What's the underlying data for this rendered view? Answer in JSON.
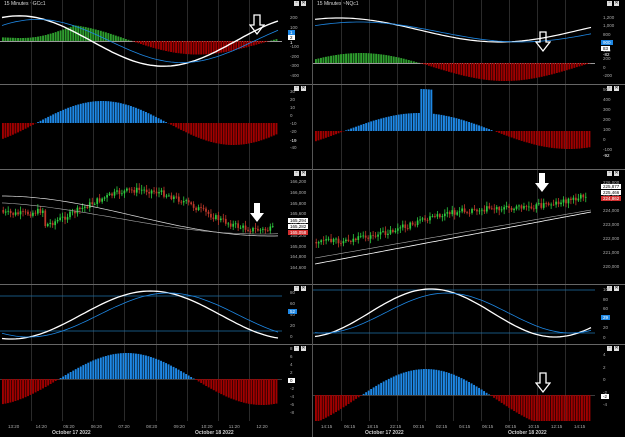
{
  "left": {
    "title": "15 Minutes ~GCc1",
    "macd": {
      "scale": [
        "200",
        "100",
        "0",
        "-100",
        "-200",
        "-300",
        "-400"
      ],
      "tags": [
        {
          "text": "1",
          "bg": "#1e88e5"
        },
        {
          "text": "2",
          "bg": "#ffffff"
        },
        {
          "text": "1",
          "bg": "#000000"
        }
      ]
    },
    "osc": {
      "scale": [
        "30",
        "20",
        "10",
        "0",
        "-10",
        "-20",
        "-30",
        "-40"
      ],
      "tag": "-19"
    },
    "price": {
      "scale": [
        "166,200",
        "166,000",
        "165,800",
        "165,600",
        "165,400",
        "165,200",
        "165,000",
        "164,800",
        "164,600"
      ],
      "tags": [
        {
          "text": "165,294",
          "bg": "#ffffff"
        },
        {
          "text": "165,282",
          "bg": "#ffffff"
        },
        {
          "text": "165,058",
          "bg": "#d32f2f"
        }
      ]
    },
    "stoch": {
      "scale": [
        "80",
        "60",
        "40",
        "20",
        "0"
      ],
      "tag": "52"
    },
    "hist": {
      "scale": [
        "8",
        "6",
        "4",
        "2",
        "0",
        "-2",
        "-4",
        "-6",
        "-8"
      ],
      "tag": "0"
    },
    "xaxis": [
      "13:20",
      "14:20",
      "05:20",
      "06:20",
      "07:20",
      "08:20",
      "09:20",
      "10:20",
      "11:20",
      "12:20"
    ],
    "dates": [
      "October 17 2022",
      "October 18 2022"
    ]
  },
  "right": {
    "title": "15 Minutes ~NQc1",
    "macd": {
      "scale": [
        "1,200",
        "1,000",
        "800",
        "600",
        "400",
        "200",
        "0",
        "-200"
      ],
      "tags": [
        {
          "text": "900",
          "bg": "#1e88e5"
        },
        {
          "text": "83",
          "bg": "#ffffff"
        },
        {
          "text": "-82",
          "bg": "#000000"
        }
      ]
    },
    "osc": {
      "scale": [
        "500",
        "400",
        "300",
        "200",
        "100",
        "0",
        "-100"
      ],
      "tag": "-92"
    },
    "price": {
      "scale": [
        "226,000",
        "225,000",
        "224,000",
        "223,000",
        "222,000",
        "221,000",
        "220,000"
      ],
      "tags": [
        {
          "text": "225,877",
          "bg": "#ffffff"
        },
        {
          "text": "225,466",
          "bg": "#ffffff"
        },
        {
          "text": "224,862",
          "bg": "#d32f2f"
        }
      ]
    },
    "stoch": {
      "scale": [
        "100",
        "80",
        "60",
        "40",
        "20",
        "0"
      ],
      "tag": "29"
    },
    "hist": {
      "scale": [
        "4",
        "2",
        "0",
        "-2",
        "-4"
      ],
      "tag": "-2"
    },
    "xaxis": [
      "14:15",
      "06:15",
      "18:15",
      "22:15",
      "00:15",
      "02:15",
      "04:15",
      "06:15",
      "08:15",
      "10:15",
      "12:15",
      "14:15"
    ],
    "dates": [
      "October 17 2022",
      "October 18 2022"
    ]
  },
  "colors": {
    "bull": "#2ecc40",
    "bear": "#c0392b",
    "blue": "#1e88e5",
    "green": "#2e9e2e",
    "red": "#a00000"
  }
}
